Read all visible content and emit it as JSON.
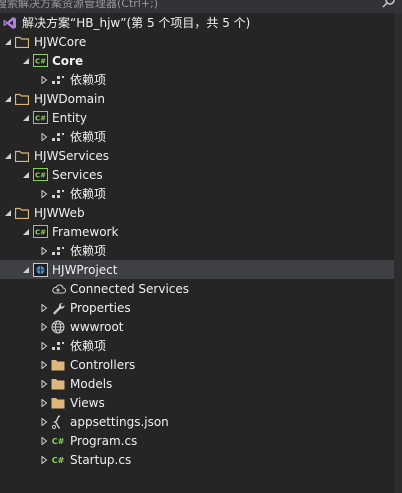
{
  "search": {
    "placeholder": "搜索解决方案资源管理器(Ctrl+;)"
  },
  "solution": {
    "label": "解决方案“HB_hjw”(第 5 个项目，共 5 个)"
  },
  "nodes": [
    {
      "label": "HJWCore"
    },
    {
      "label": "Core"
    },
    {
      "label": "依赖项"
    },
    {
      "label": "HJWDomain"
    },
    {
      "label": "Entity"
    },
    {
      "label": "依赖项"
    },
    {
      "label": "HJWServices"
    },
    {
      "label": "Services"
    },
    {
      "label": "依赖项"
    },
    {
      "label": "HJWWeb"
    },
    {
      "label": "Framework"
    },
    {
      "label": "依赖项"
    },
    {
      "label": "HJWProject"
    },
    {
      "label": "Connected Services"
    },
    {
      "label": "Properties"
    },
    {
      "label": "wwwroot"
    },
    {
      "label": "依赖项"
    },
    {
      "label": "Controllers"
    },
    {
      "label": "Models"
    },
    {
      "label": "Views"
    },
    {
      "label": "appsettings.json"
    },
    {
      "label": "Program.cs"
    },
    {
      "label": "Startup.cs"
    }
  ],
  "colors": {
    "background": "#252526",
    "folder": "#dcb67a",
    "csproj_green": "#8ed15a",
    "selection": "#3f3f46"
  }
}
